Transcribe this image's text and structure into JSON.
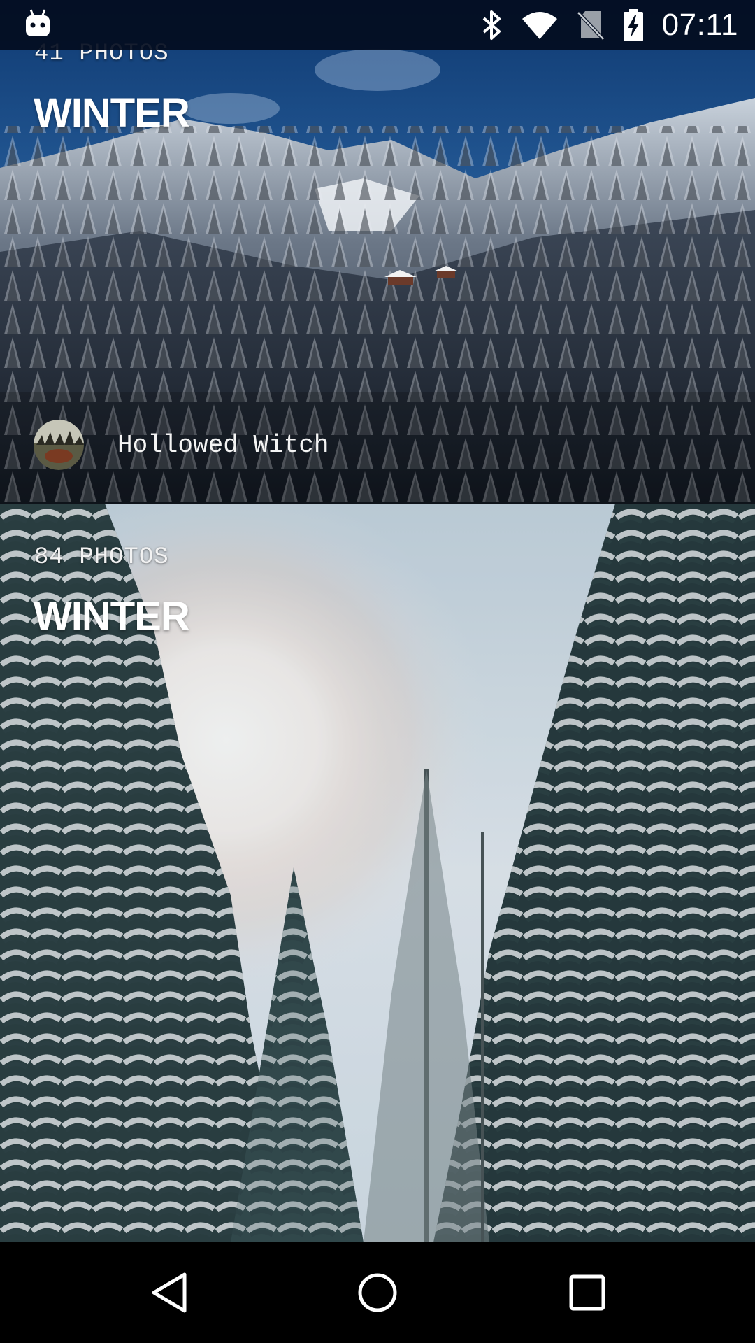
{
  "status_bar": {
    "time": "07:11",
    "icons": [
      "android-notification-icon",
      "bluetooth-icon",
      "wifi-icon",
      "no-sim-icon",
      "battery-charging-icon"
    ]
  },
  "collections": [
    {
      "photo_count": "41 PHOTOS",
      "title": "WINTER",
      "author": "Hollowed Witch"
    },
    {
      "photo_count": "84 PHOTOS",
      "title": "WINTER"
    }
  ],
  "nav_bar": {
    "buttons": [
      "back-icon",
      "home-icon",
      "recents-icon"
    ]
  },
  "colors": {
    "status_bar_bg": "#030c1e",
    "nav_bar_bg": "#000000",
    "text_primary": "#ffffff"
  }
}
